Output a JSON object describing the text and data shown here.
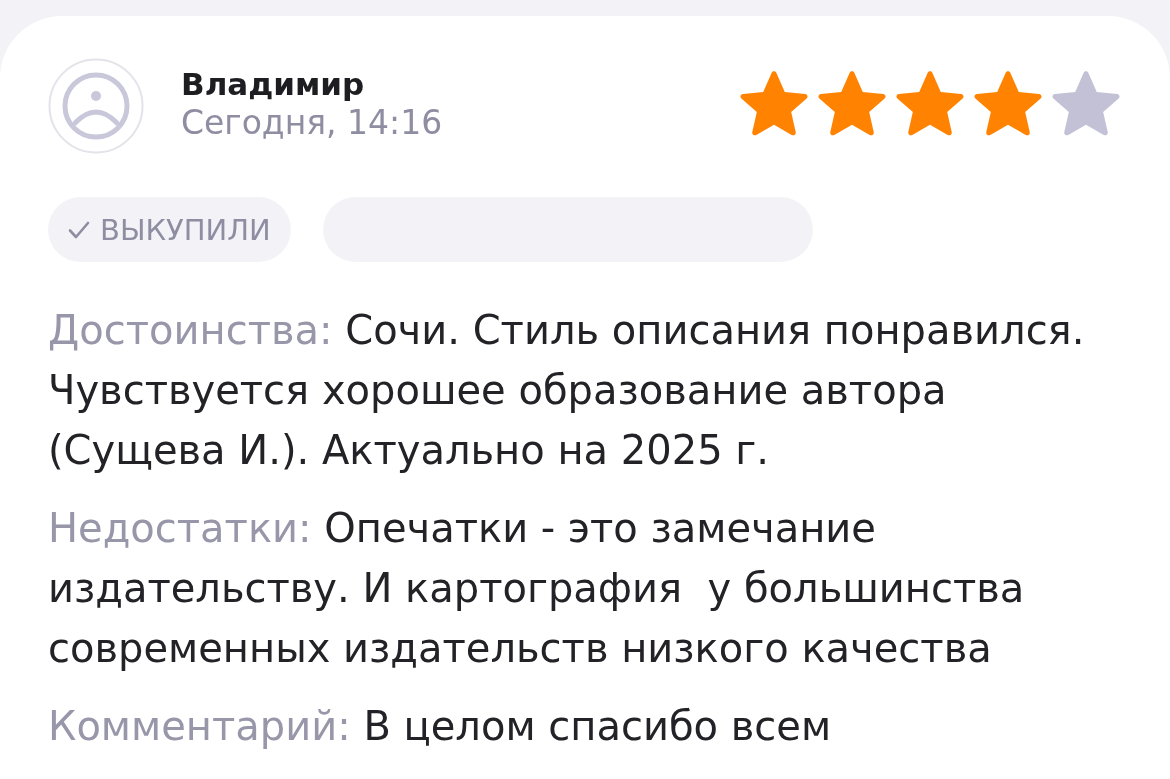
{
  "review": {
    "author": "Владимир",
    "date": "Сегодня, 14:16",
    "stars": 4,
    "tags": [
      {
        "kind": "verified",
        "text": "ВЫКУПИЛИ"
      },
      {
        "kind": "blank"
      }
    ],
    "sections": [
      {
        "label": "Достоинства:",
        "text": "Сочи. Стиль описания понравился. Чувствуется хорошее образование автора (Сущева И.). Актуально на 2025 г."
      },
      {
        "label": "Недостатки:",
        "text": "Опечатки - это замечание издательству. И картография  у большинства современных издательств низкого качества"
      },
      {
        "label": "Комментарий:",
        "text": "В целом спасибо всем"
      }
    ]
  }
}
